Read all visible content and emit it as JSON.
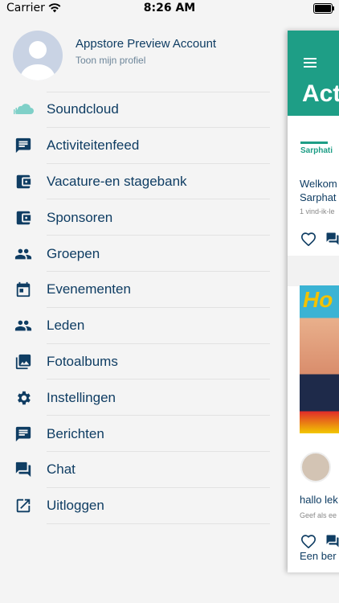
{
  "status_bar": {
    "carrier": "Carrier",
    "time": "8:26 AM"
  },
  "profile": {
    "name": "Appstore Preview Account",
    "subtitle": "Toon mijn profiel"
  },
  "menu": {
    "items": [
      {
        "label": "Soundcloud",
        "icon": "soundcloud-icon"
      },
      {
        "label": "Activiteitenfeed",
        "icon": "message-icon"
      },
      {
        "label": "Vacature-en stagebank",
        "icon": "wallet-icon"
      },
      {
        "label": "Sponsoren",
        "icon": "wallet-icon"
      },
      {
        "label": "Groepen",
        "icon": "people-icon"
      },
      {
        "label": "Evenementen",
        "icon": "calendar-icon"
      },
      {
        "label": "Leden",
        "icon": "people-icon"
      },
      {
        "label": "Fotoalbums",
        "icon": "photo-library-icon"
      },
      {
        "label": "Instellingen",
        "icon": "gear-icon"
      },
      {
        "label": "Berichten",
        "icon": "message-icon"
      },
      {
        "label": "Chat",
        "icon": "chat-icon"
      },
      {
        "label": "Uitloggen",
        "icon": "exit-icon"
      }
    ]
  },
  "feed": {
    "title": "Act",
    "logo_text": "Sarphati",
    "post1_line1": "Welkom",
    "post1_line2": "Sarphat",
    "post1_meta": "1 vind-ik-le",
    "post2_text": "hallo lek",
    "post2_meta": "Geef als ee",
    "post3_text": "Een ber",
    "photo_text": "Ho"
  },
  "colors": {
    "accent": "#1e9e86",
    "text": "#0f3d63",
    "icon": "#0f3d63"
  }
}
